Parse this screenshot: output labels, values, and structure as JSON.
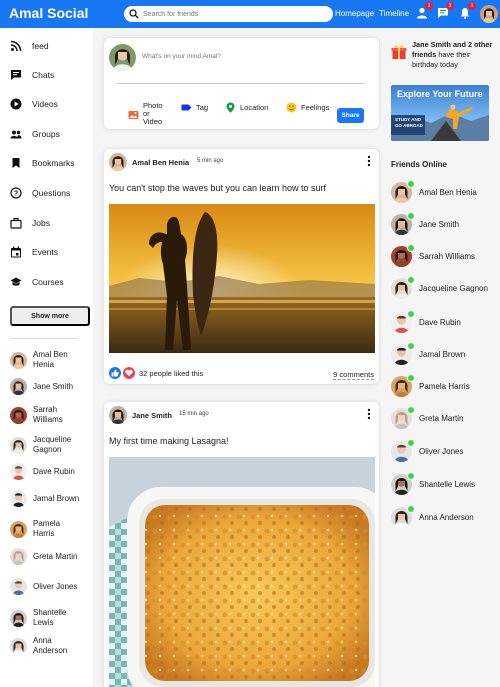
{
  "topbar": {
    "logo": "Amal Social",
    "search_placeholder": "Search for friends",
    "links": [
      "Homepage",
      "Timeline"
    ],
    "badges": {
      "friends": "1",
      "messages": "3",
      "notifications": "1"
    }
  },
  "sidebar": {
    "items": [
      {
        "label": "feed",
        "icon": "rss-icon"
      },
      {
        "label": "Chats",
        "icon": "chat-icon"
      },
      {
        "label": "Videos",
        "icon": "play-icon"
      },
      {
        "label": "Groups",
        "icon": "group-icon"
      },
      {
        "label": "Bookmarks",
        "icon": "bookmark-icon"
      },
      {
        "label": "Questions",
        "icon": "question-icon"
      },
      {
        "label": "Jobs",
        "icon": "briefcase-icon"
      },
      {
        "label": "Events",
        "icon": "calendar-icon"
      },
      {
        "label": "Courses",
        "icon": "graduation-icon"
      }
    ],
    "show_more": "Show more",
    "friends": [
      "Amal Ben Henia",
      "Jane Smith",
      "Sarrah Williams",
      "Jacqueline Gagnon",
      "Dave Rubin",
      "Jamal Brown",
      "Pamela Harris",
      "Greta Martin",
      "Oliver Jones",
      "Shantelle Lewis",
      "Anna Anderson"
    ]
  },
  "share": {
    "placeholder": "What's on your mind Amal?",
    "options": [
      "Photo or Video",
      "Tag",
      "Location",
      "Feelings"
    ],
    "button": "Share"
  },
  "posts": [
    {
      "author": "Amal Ben Henia",
      "time": "5 min ago",
      "text": "You can't stop the waves but you can learn how to surf",
      "likes": "32 people liked this",
      "comments": "9 comments"
    },
    {
      "author": "Jane Smith",
      "time": "15 min ago",
      "text": "My first time making Lasagna!"
    }
  ],
  "right": {
    "birthday_name": "Jane Smith",
    "birthday_rest": " and 2 other friends",
    "birthday_end": " have their birthday today",
    "ad_title": "Explore Your Future",
    "ad_sub1": "STUDY AND",
    "ad_sub2": "GO ABROAD",
    "online_title": "Friends Online",
    "online": [
      "Amal Ben Henia",
      "Jane Smith",
      "Sarrah Williams",
      "Jacqueline Gagnon",
      "Dave Rubin",
      "Jamal Brown",
      "Pamela Harris",
      "Greta Martin",
      "Oliver Jones",
      "Shantelle Lewis",
      "Anna Anderson"
    ]
  },
  "colors": {
    "brand": "#1877f2",
    "online": "#32d94b",
    "badge": "#e41e3f"
  }
}
